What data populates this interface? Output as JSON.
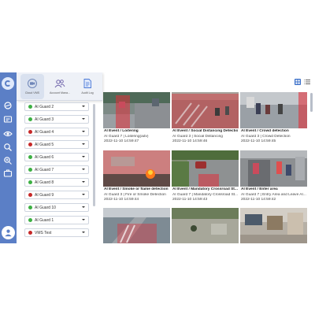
{
  "quick_panel": {
    "items": [
      {
        "label": "Cloud VMS",
        "icon": "camera-icon",
        "active": true
      },
      {
        "label": "Account Mana...",
        "icon": "users-icon",
        "active": false
      },
      {
        "label": "Audit Log",
        "icon": "document-icon",
        "active": false
      }
    ]
  },
  "rail": {
    "icons": [
      "logo-icon",
      "cloud-icon",
      "message-icon",
      "eye-icon",
      "search-icon",
      "zoom-icon",
      "briefcase-icon",
      "avatar-icon"
    ]
  },
  "guards": [
    {
      "label": "AI Guard 2",
      "status_color": "#3cb043"
    },
    {
      "label": "AI Guard 3",
      "status_color": "#3cb043"
    },
    {
      "label": "AI Guard 4",
      "status_color": "#c62828"
    },
    {
      "label": "AI Guard 5",
      "status_color": "#c62828"
    },
    {
      "label": "AI Guard 6",
      "status_color": "#3cb043"
    },
    {
      "label": "AI Guard 7",
      "status_color": "#3cb043"
    },
    {
      "label": "AI Guard 8",
      "status_color": "#3cb043"
    },
    {
      "label": "AI Guard 9",
      "status_color": "#c62828"
    },
    {
      "label": "AI Guard 10",
      "status_color": "#3cb043"
    },
    {
      "label": "AI Guard 1",
      "status_color": "#3cb043"
    },
    {
      "label": "VMS Test",
      "status_color": "#c62828"
    }
  ],
  "view_toggle": {
    "grid_icon": "grid-view-icon",
    "list_icon": "list-view-icon"
  },
  "events": [
    {
      "title": "AI Event / Loitering",
      "source": "AI Guard 7 | Loitering(adv)",
      "time": "2022-11-10 14:59:47"
    },
    {
      "title": "AI Event / Social Distancing Detection",
      "source": "AI Guard 3 | Social Distancing",
      "time": "2022-11-10 14:59:46"
    },
    {
      "title": "AI Event / Crowd detection",
      "source": "AI Guard 3 | Crowd Detection",
      "time": "2022-11-10 14:59:45"
    },
    {
      "title": "AI Event / Smoke or flame detection",
      "source": "AI Guard 3 | Fire or Smoke Detection",
      "time": "2022-11-10 14:59:44"
    },
    {
      "title": "AI Event / Mandatory Crossroad St...",
      "source": "AI Guard 7 | Mandatory Crossroad St...",
      "time": "2022-11-10 14:59:43"
    },
    {
      "title": "AI Event / Enter area",
      "source": "AI Guard 7 | Entry Area and Leave Ar...",
      "time": "2022-11-10 14:59:42"
    },
    {
      "title": "",
      "source": "",
      "time": ""
    },
    {
      "title": "",
      "source": "",
      "time": ""
    },
    {
      "title": "",
      "source": "",
      "time": ""
    }
  ],
  "colors": {
    "rail": "#5b7fc6",
    "online": "#3cb043",
    "offline": "#c62828",
    "alert_overlay": "#e0303a"
  }
}
